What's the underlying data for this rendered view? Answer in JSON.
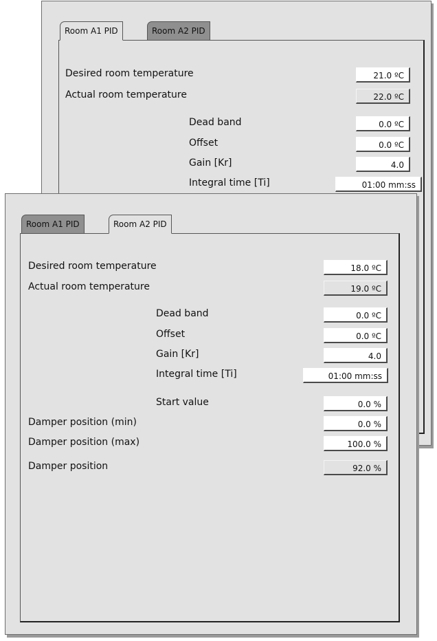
{
  "back_window": {
    "tabs": [
      {
        "label": "Room A1 PID",
        "active": true
      },
      {
        "label": "Room A2 PID",
        "active": false
      }
    ],
    "desired_label": "Desired room temperature",
    "desired_value": "21.0 ºC",
    "actual_label": "Actual room temperature",
    "actual_value": "22.0 ºC",
    "dead_band_label": "Dead band",
    "dead_band_value": "0.0 ºC",
    "offset_label": "Offset",
    "offset_value": "0.0 ºC",
    "gain_label": "Gain [Kr]",
    "gain_value": "4.0",
    "integral_label": "Integral time [Ti]",
    "integral_value": "01:00 mm:ss"
  },
  "front_window": {
    "tabs": [
      {
        "label": "Room A1 PID",
        "active": false
      },
      {
        "label": "Room A2 PID",
        "active": true
      }
    ],
    "desired_label": "Desired room temperature",
    "desired_value": "18.0 ºC",
    "actual_label": "Actual room temperature",
    "actual_value": "19.0 ºC",
    "dead_band_label": "Dead band",
    "dead_band_value": "0.0 ºC",
    "offset_label": "Offset",
    "offset_value": "0.0 ºC",
    "gain_label": "Gain [Kr]",
    "gain_value": "4.0",
    "integral_label": "Integral time [Ti]",
    "integral_value": "01:00 mm:ss",
    "start_label": "Start value",
    "start_value": "0.0 %",
    "damper_min_label": "Damper position (min)",
    "damper_min_value": "0.0 %",
    "damper_max_label": "Damper position (max)",
    "damper_max_value": "100.0 %",
    "damper_label": "Damper position",
    "damper_value": "92.0 %"
  },
  "colors": {
    "background": "#e2e2e2",
    "inactive_tab": "#8f8f8f",
    "field": "#ffffff",
    "border": "#222222"
  }
}
